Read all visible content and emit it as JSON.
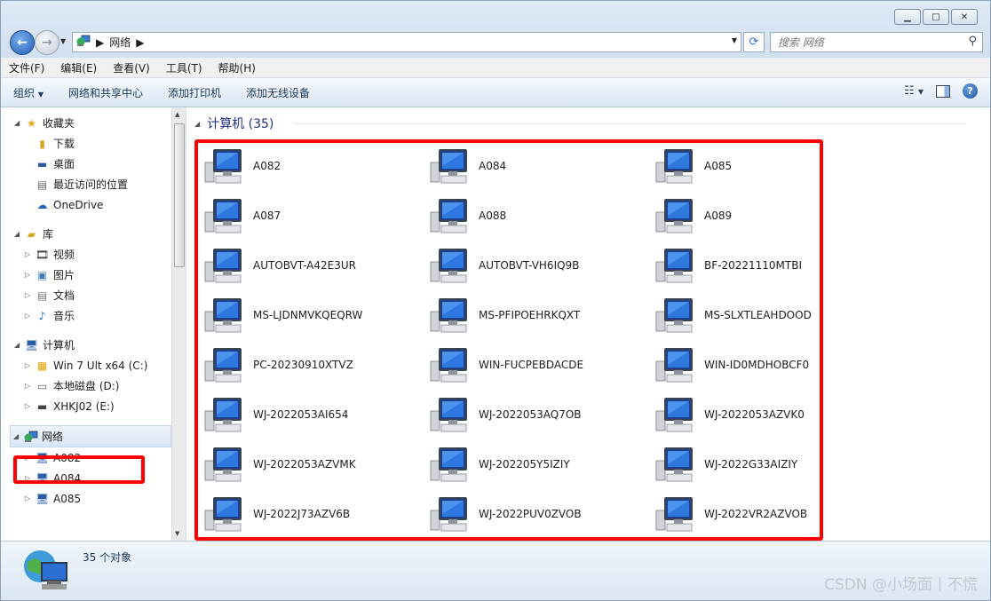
{
  "window": {
    "title_controls": [
      "minimize",
      "maximize",
      "close"
    ]
  },
  "address": {
    "crumb": "网络",
    "search_placeholder": "搜索 网络"
  },
  "menu": [
    "文件(F)",
    "编辑(E)",
    "查看(V)",
    "工具(T)",
    "帮助(H)"
  ],
  "commands": {
    "organize": "组织",
    "network_center": "网络和共享中心",
    "add_printer": "添加打印机",
    "add_wireless": "添加无线设备"
  },
  "nav": {
    "favorites": "收藏夹",
    "fav_items": [
      "下载",
      "桌面",
      "最近访问的位置",
      "OneDrive"
    ],
    "library": "库",
    "lib_items": [
      "视频",
      "图片",
      "文档",
      "音乐"
    ],
    "computer": "计算机",
    "drives": [
      "Win 7 Ult x64 (C:)",
      "本地磁盘 (D:)",
      "XHKJ02 (E:)"
    ],
    "network": "网络",
    "net_items": [
      "A082",
      "A084",
      "A085"
    ]
  },
  "group": {
    "title": "计算机 (35)"
  },
  "computers": [
    "A082",
    "A084",
    "A085",
    "A087",
    "A088",
    "A089",
    "AUTOBVT-A42E3UR",
    "AUTOBVT-VH6IQ9B",
    "BF-20221110MTBI",
    "MS-LJDNMVKQEQRW",
    "MS-PFIPOEHRKQXT",
    "MS-SLXTLEAHDOOD",
    "PC-20230910XTVZ",
    "WIN-FUCPEBDACDE",
    "WIN-ID0MDHOBCF0",
    "WJ-2022053AI654",
    "WJ-2022053AQ7OB",
    "WJ-2022053AZVK0",
    "WJ-2022053AZVMK",
    "WJ-202205Y5IZIY",
    "WJ-2022G33AIZIY",
    "WJ-2022J73AZV6B",
    "WJ-2022PUV0ZVOB",
    "WJ-2022VR2AZVOB"
  ],
  "status": {
    "count": "35 个对象"
  },
  "watermark": "CSDN @小场面丨不慌"
}
